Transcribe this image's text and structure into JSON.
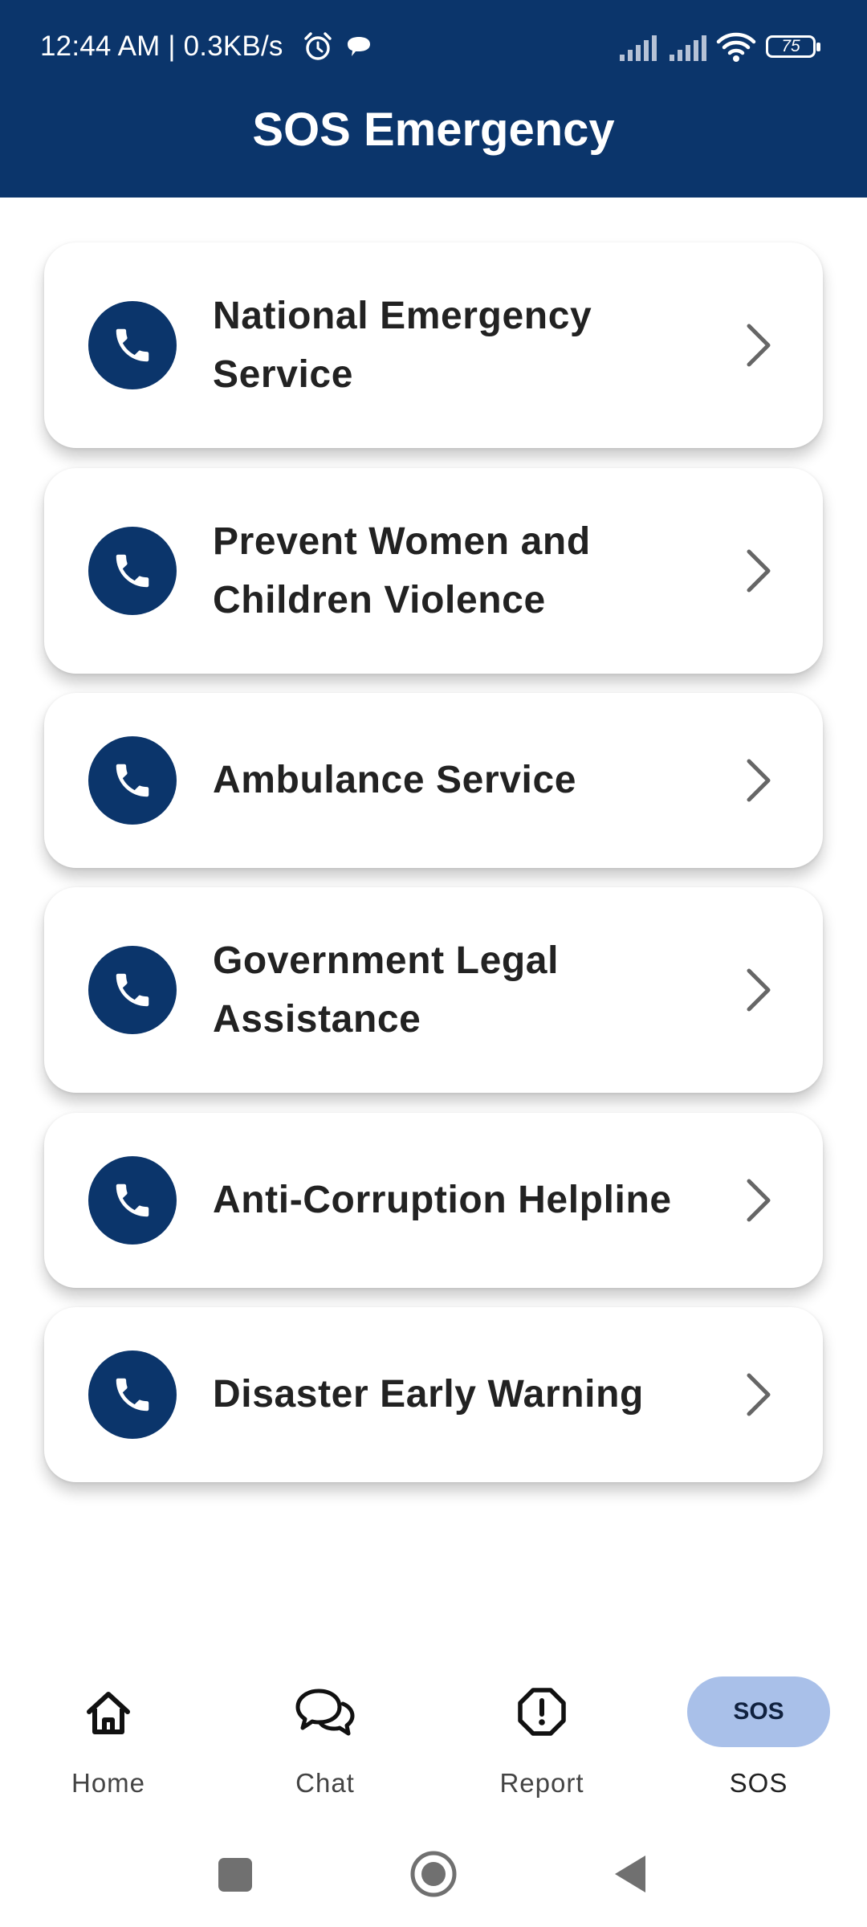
{
  "status_bar": {
    "time_speed": "12:44 AM | 0.3KB/s",
    "battery": "75",
    "icons": [
      "alarm-icon",
      "chat-bubble-icon",
      "signal-icon",
      "signal-icon",
      "wifi-icon",
      "battery-icon"
    ]
  },
  "header": {
    "title": "SOS Emergency",
    "background": "#0b356b"
  },
  "services": [
    {
      "label": "National Emergency Service",
      "icon": "phone-icon"
    },
    {
      "label": "Prevent Women and Children Violence",
      "icon": "phone-icon"
    },
    {
      "label": "Ambulance Service",
      "icon": "phone-icon"
    },
    {
      "label": "Government Legal Assistance",
      "icon": "phone-icon"
    },
    {
      "label": "Anti-Corruption Helpline",
      "icon": "phone-icon"
    },
    {
      "label": "Disaster Early Warning",
      "icon": "phone-icon"
    }
  ],
  "bottom_nav": {
    "items": [
      {
        "label": "Home",
        "icon": "home-icon"
      },
      {
        "label": "Chat",
        "icon": "chat-icon"
      },
      {
        "label": "Report",
        "icon": "alert-icon"
      },
      {
        "label": "SOS",
        "icon": "sos-icon",
        "badge": "SOS",
        "active": true
      }
    ],
    "active_color": "#a9c0e9"
  },
  "system_nav": [
    "recents-button",
    "home-button",
    "back-button"
  ]
}
